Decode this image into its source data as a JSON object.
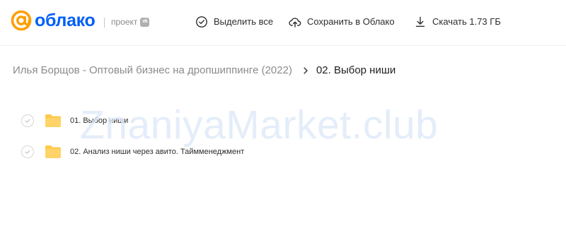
{
  "header": {
    "logo_text": "облако",
    "project_label": "проект",
    "vk_badge": "vk",
    "actions": {
      "select_all": "Выделить все",
      "save_to_cloud": "Сохранить в Облако",
      "download": "Скачать 1.73 ГБ"
    }
  },
  "breadcrumb": {
    "parent": "Илья Борщов - Оптовый бизнес на дропшиппинге (2022)",
    "current": "02. Выбор ниши"
  },
  "files": [
    {
      "name": "01. Выбор ниши",
      "type": "folder"
    },
    {
      "name": "02. Анализ ниши через авито. Тайм­менеджмент",
      "type": "folder"
    }
  ],
  "watermark": "ZnaniyaMarket.club",
  "colors": {
    "brand_orange": "#ff9e00",
    "brand_blue": "#005ff9",
    "folder_yellow": "#ffc94a"
  }
}
